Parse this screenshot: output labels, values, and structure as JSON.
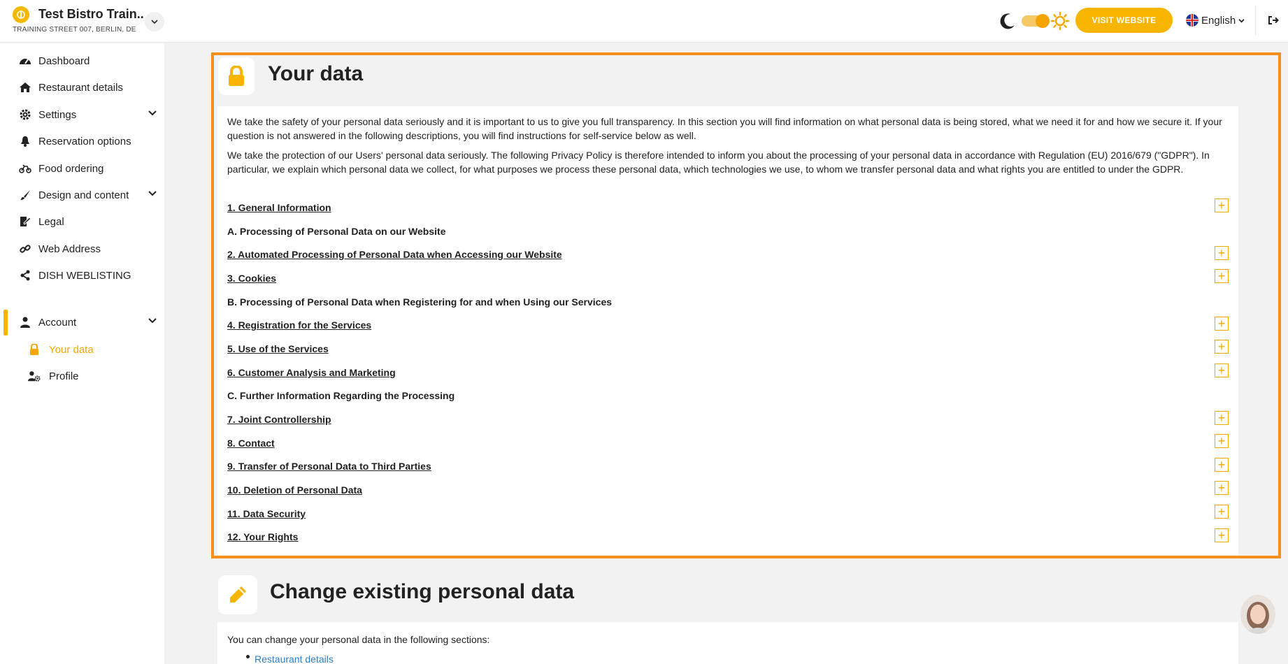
{
  "header": {
    "restaurant_name": "Test Bistro Train..",
    "address": "TRAINING STREET 007, BERLIN, DE",
    "visit_button": "VISIT WEBSITE",
    "language": "English"
  },
  "sidebar": {
    "items": [
      {
        "label": "Dashboard",
        "icon": "gauge-icon"
      },
      {
        "label": "Restaurant details",
        "icon": "home-icon"
      },
      {
        "label": "Settings",
        "icon": "gear-icon"
      },
      {
        "label": "Reservation options",
        "icon": "bell-icon"
      },
      {
        "label": "Food ordering",
        "icon": "bike-icon"
      },
      {
        "label": "Design and content",
        "icon": "brush-icon"
      },
      {
        "label": "Legal",
        "icon": "legal-icon"
      },
      {
        "label": "Web Address",
        "icon": "link-icon"
      },
      {
        "label": "DISH WEBLISTING",
        "icon": "share-icon"
      },
      {
        "label": "Account",
        "icon": "user-icon"
      },
      {
        "label": "Your data",
        "icon": "lock-icon"
      },
      {
        "label": "Profile",
        "icon": "user-gear-icon"
      }
    ]
  },
  "main": {
    "title": "Your data",
    "intro1": "We take the safety of your personal data seriously and it is important to us to give you full transparency. In this section you will find information on what personal data is being stored, what we need it for and how we secure it. If your question is not answered in the following descriptions, you will find instructions for self-service below as well.",
    "intro2": "We take the protection of our Users' personal data seriously. The following Privacy Policy is therefore intended to inform you about the processing of your personal data in accordance with Regulation (EU) 2016/679 (\"GDPR\"). In particular, we explain which personal data we collect, for what purposes we process these personal data, which technologies we use, to whom we transfer personal data and what rights you are entitled to under the GDPR.",
    "sections": [
      "1. General Information",
      "A. Processing of Personal Data on our Website",
      "2. Automated Processing of Personal Data when Accessing our Website",
      "3. Cookies",
      "B. Processing of Personal Data when Registering for and when Using our Services",
      "4. Registration for the Services",
      "5. Use of the Services",
      "6. Customer Analysis and Marketing",
      "C. Further Information Regarding the Processing",
      "7. Joint Controllership",
      "8. Contact",
      "9. Transfer of Personal Data to Third Parties",
      "10. Deletion of Personal Data",
      "11. Data Security",
      "12. Your Rights"
    ],
    "change_title": "Change existing personal data",
    "change_text": "You can change your personal data in the following sections:",
    "change_link": "Restaurant details"
  },
  "colors": {
    "accent": "#f7b500",
    "highlight_border": "#f78f1e",
    "link": "#2a7fc9"
  }
}
